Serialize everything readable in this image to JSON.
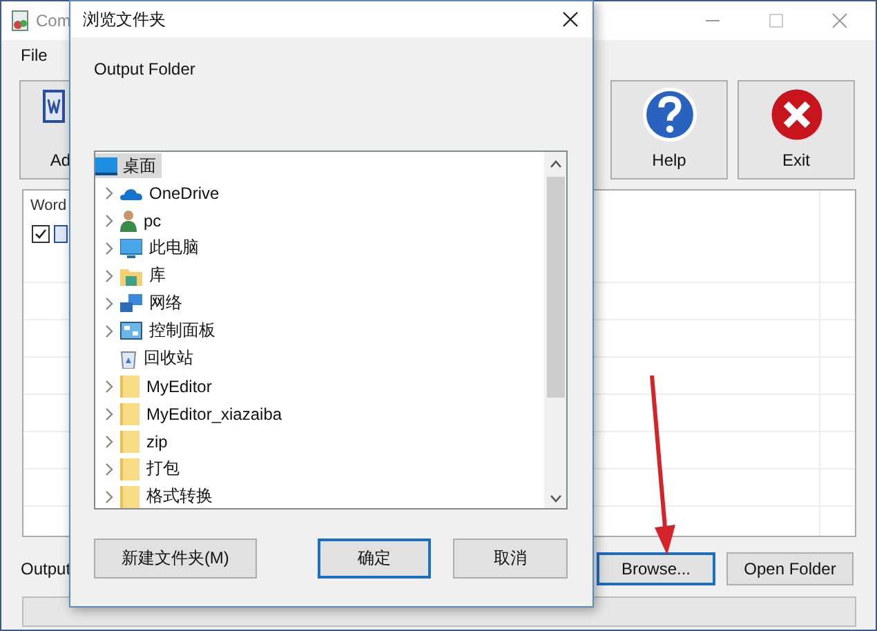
{
  "main_window": {
    "title": "Com",
    "menu": [
      {
        "label": "File"
      }
    ],
    "toolbar": [
      {
        "label": "Ad",
        "kind": "document"
      },
      {
        "label": "Help",
        "kind": "help"
      },
      {
        "label": "Exit",
        "kind": "exit"
      }
    ],
    "file_list": {
      "columns": [
        "Word"
      ],
      "rows": [
        {
          "checked": true
        }
      ]
    },
    "output_label": "Output",
    "buttons": [
      {
        "label": "Browse...",
        "focused": true
      },
      {
        "label": "Open Folder",
        "focused": false
      }
    ]
  },
  "dialog": {
    "title": "浏览文件夹",
    "prompt": "Output Folder",
    "tree": [
      {
        "label": "桌面",
        "kind": "desktop",
        "selected": true,
        "children": [
          {
            "label": "OneDrive",
            "kind": "cloud",
            "expandable": true,
            "selected": false
          },
          {
            "label": "pc",
            "kind": "user",
            "expandable": true,
            "selected": false
          },
          {
            "label": "此电脑",
            "kind": "computer",
            "expandable": true,
            "selected": false
          },
          {
            "label": "库",
            "kind": "library",
            "expandable": true,
            "selected": false
          },
          {
            "label": "网络",
            "kind": "network",
            "expandable": true,
            "selected": false
          },
          {
            "label": "控制面板",
            "kind": "panel",
            "expandable": true,
            "selected": false
          },
          {
            "label": "回收站",
            "kind": "bin",
            "expandable": false,
            "selected": false
          },
          {
            "label": "MyEditor",
            "kind": "folder",
            "expandable": true,
            "selected": false
          },
          {
            "label": "MyEditor_xiazaiba",
            "kind": "folder",
            "expandable": true,
            "selected": false
          },
          {
            "label": "zip",
            "kind": "folder",
            "expandable": true,
            "selected": false
          },
          {
            "label": "打包",
            "kind": "folder",
            "expandable": true,
            "selected": false
          },
          {
            "label": "格式转换",
            "kind": "folder",
            "expandable": true,
            "selected": false
          }
        ]
      }
    ],
    "buttons": [
      {
        "label": "新建文件夹(M)",
        "default": false
      },
      {
        "label": "确定",
        "default": true
      },
      {
        "label": "取消",
        "default": false
      }
    ]
  }
}
